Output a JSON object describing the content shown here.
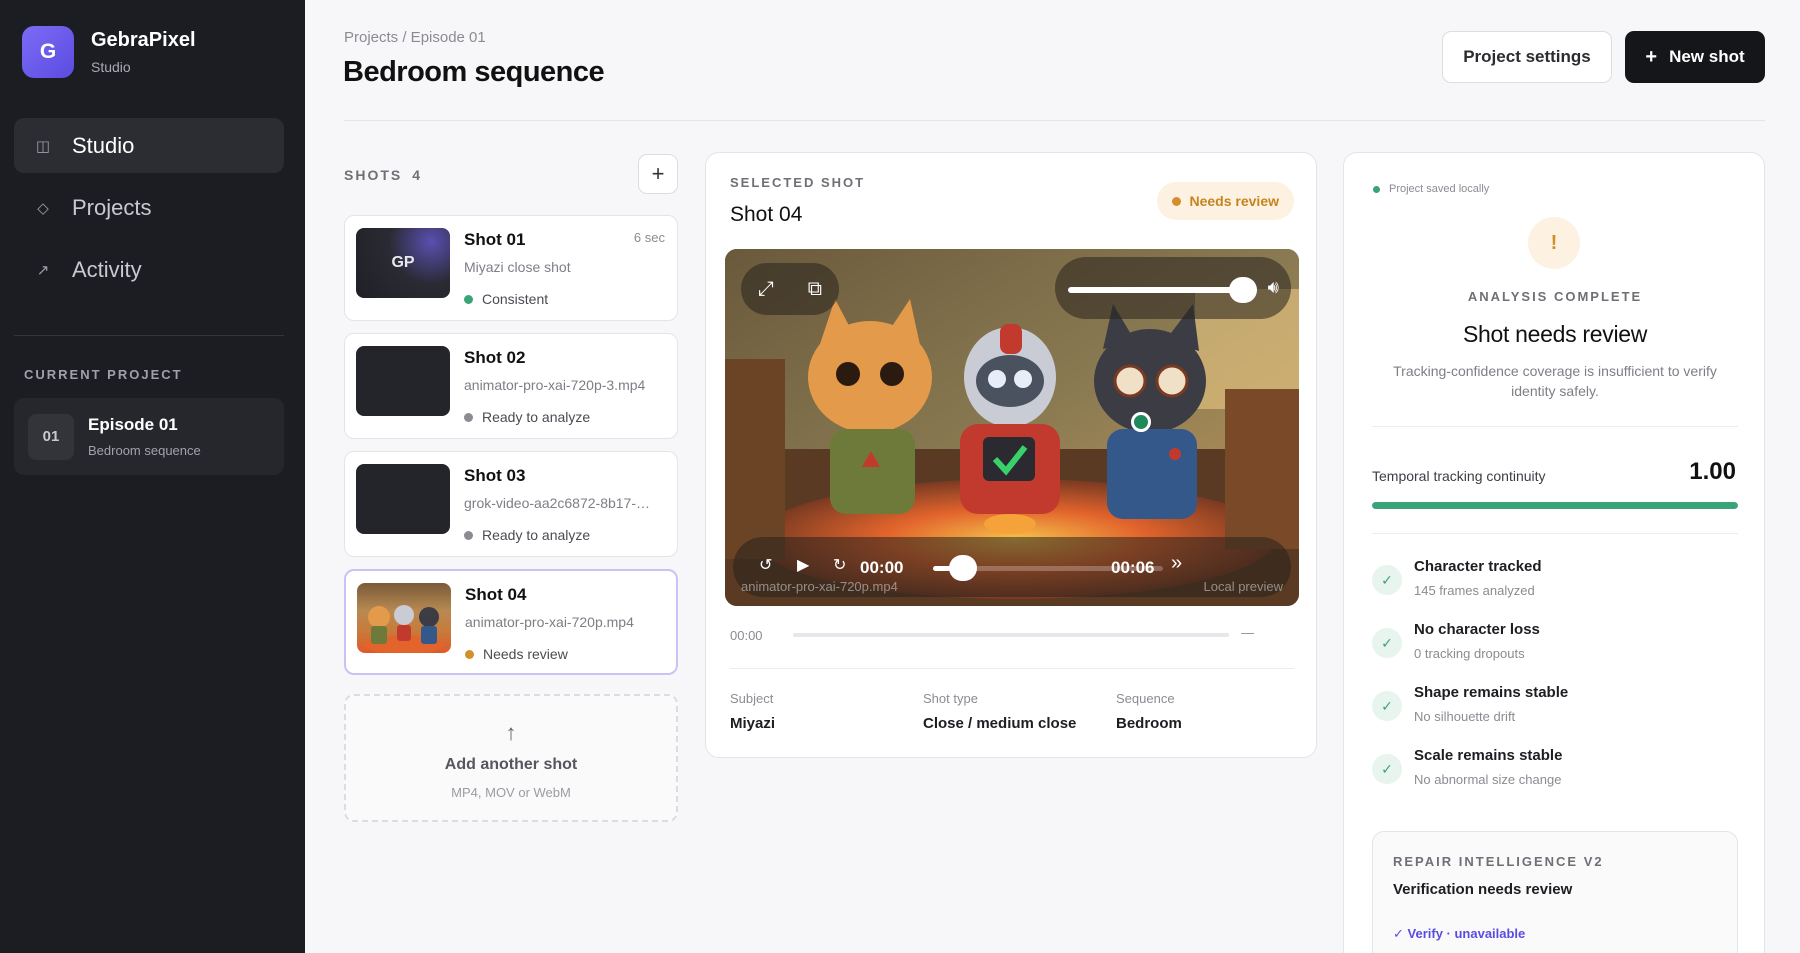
{
  "sidebar": {
    "brand_initial": "G",
    "brand_name": "GebraPixel",
    "brand_sub": "Studio",
    "nav": [
      {
        "label": "Studio",
        "icon": "panel-icon"
      },
      {
        "label": "Projects",
        "icon": "diamond-icon"
      },
      {
        "label": "Activity",
        "icon": "arrow-up-right-icon"
      }
    ],
    "current_project_label": "CURRENT PROJECT",
    "project": {
      "num": "01",
      "title": "Episode 01",
      "sub": "Bedroom sequence"
    }
  },
  "header": {
    "breadcrumb": "Projects / Episode 01",
    "title": "Bedroom sequence",
    "settings_label": "Project settings",
    "new_shot_plus": "+",
    "new_shot_label": "New shot"
  },
  "shots": {
    "label": "SHOTS",
    "count": "4",
    "add_plus": "+",
    "items": [
      {
        "title": "Shot 01",
        "file": "Miyazi close shot",
        "status": "Consistent",
        "status_color": "#3aa377",
        "duration": "6 sec",
        "thumb_text": "GP"
      },
      {
        "title": "Shot 02",
        "file": "animator-pro-xai-720p-3.mp4",
        "status": "Ready to analyze",
        "status_color": "#8a8c92",
        "duration": ""
      },
      {
        "title": "Shot 03",
        "file": "grok-video-aa2c6872-8b17-…",
        "status": "Ready to analyze",
        "status_color": "#8a8c92",
        "duration": ""
      },
      {
        "title": "Shot 04",
        "file": "animator-pro-xai-720p.mp4",
        "status": "Needs review",
        "status_color": "#d38f2c",
        "duration": ""
      }
    ],
    "upload": {
      "arrow": "↑",
      "title": "Add another shot",
      "sub": "MP4, MOV or WebM"
    }
  },
  "selected": {
    "label": "SELECTED SHOT",
    "title": "Shot 04",
    "badge": "Needs review",
    "video": {
      "current_time": "00:00",
      "total_time": "00:06",
      "filename": "animator-pro-xai-720p.mp4",
      "source": "Local preview",
      "volume": 0.9,
      "progress": 0.0
    },
    "scrub_time": "00:00",
    "scrub_end": "—",
    "meta": [
      {
        "key": "Subject",
        "value": "Miyazi"
      },
      {
        "key": "Shot type",
        "value": "Close / medium close"
      },
      {
        "key": "Sequence",
        "value": "Bedroom"
      }
    ]
  },
  "analysis": {
    "saved": "Project saved locally",
    "warn_symbol": "!",
    "label": "ANALYSIS COMPLETE",
    "title": "Shot needs review",
    "desc": "Tracking-confidence coverage is insufficient to verify identity safely.",
    "metric_label": "Temporal tracking continuity",
    "metric_value": "1.00",
    "metric_fraction": 1.0,
    "check_symbol": "✓",
    "checks": [
      {
        "title": "Character tracked",
        "sub": "145 frames analyzed"
      },
      {
        "title": "No character loss",
        "sub": "0 tracking dropouts"
      },
      {
        "title": "Shape remains stable",
        "sub": "No silhouette drift"
      },
      {
        "title": "Scale remains stable",
        "sub": "No abnormal size change"
      }
    ],
    "repair": {
      "label": "REPAIR INTELLIGENCE V2",
      "title": "Verification needs review",
      "link": "✓ Verify · unavailable"
    }
  },
  "colors": {
    "accent": "#5b4ce0",
    "success": "#3aa377",
    "warning": "#d38f2c",
    "sidebar": "#1c1d22"
  }
}
